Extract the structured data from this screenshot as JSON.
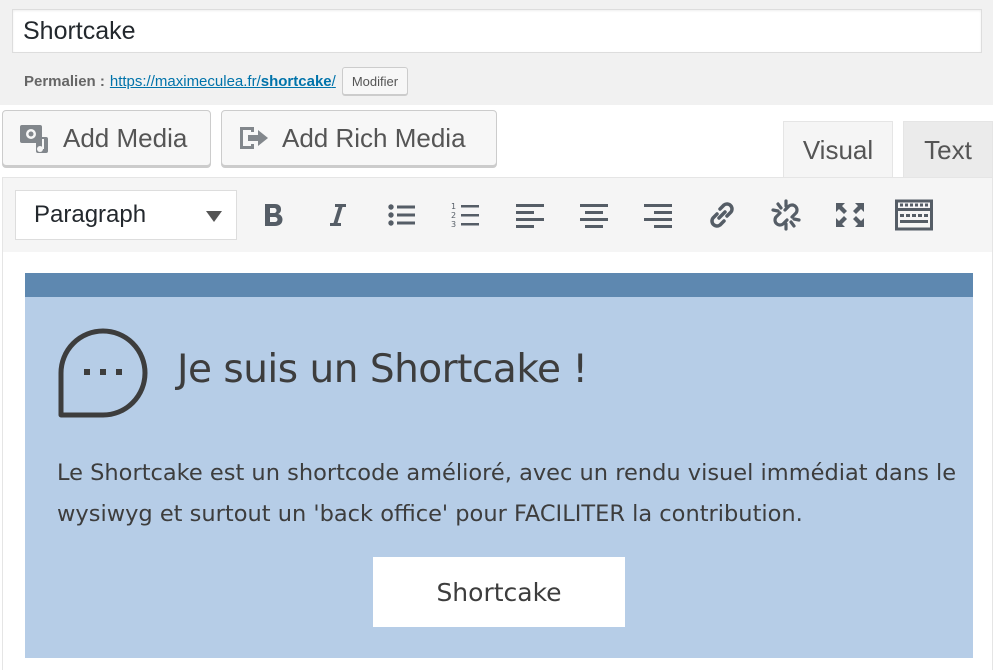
{
  "post": {
    "title": "Shortcake"
  },
  "permalink": {
    "label": "Permalien :",
    "url_base": "https://maximeculea.fr/",
    "url_slug": "shortcake",
    "url_trail": "/",
    "edit_label": "Modifier"
  },
  "media_buttons": {
    "add_media": "Add Media",
    "add_rich_media": "Add Rich Media"
  },
  "tabs": {
    "visual": "Visual",
    "text": "Text",
    "active": "Visual"
  },
  "toolbar": {
    "format_value": "Paragraph",
    "buttons": [
      "bold-icon",
      "italic-icon",
      "bulleted-list-icon",
      "numbered-list-icon",
      "align-left-icon",
      "align-center-icon",
      "align-right-icon",
      "link-icon",
      "unlink-icon",
      "fullscreen-icon",
      "toolbar-toggle-icon"
    ]
  },
  "shortcake": {
    "title": "Je suis un Shortcake !",
    "text": "Le Shortcake est un shortcode amélioré, avec un rendu visuel immédiat dans le wysiwyg et surtout un 'back office' pour FACILITER la contribution.",
    "button_label": "Shortcake",
    "colors": {
      "header_bar": "#5e88b0",
      "background": "#b6cde7"
    }
  },
  "colors": {
    "link": "#0073aa",
    "page_bg": "#f1f1f1"
  }
}
